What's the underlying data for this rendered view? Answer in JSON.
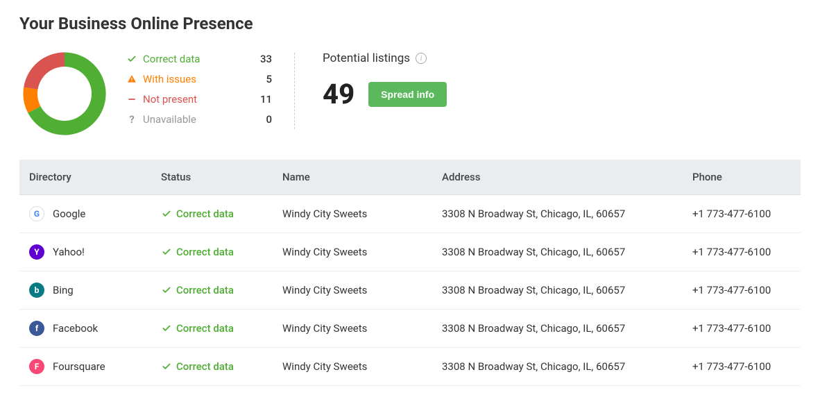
{
  "title": "Your Business Online Presence",
  "legend": {
    "correct": {
      "label": "Correct data",
      "count": 33
    },
    "with_issues": {
      "label": "With issues",
      "count": 5
    },
    "not_present": {
      "label": "Not present",
      "count": 11
    },
    "unavailable": {
      "label": "Unavailable",
      "count": 0
    }
  },
  "potential": {
    "label": "Potential listings",
    "count": 49,
    "button": "Spread info"
  },
  "table": {
    "headers": {
      "directory": "Directory",
      "status": "Status",
      "name": "Name",
      "address": "Address",
      "phone": "Phone"
    },
    "rows": [
      {
        "directory": "Google",
        "icon": "google",
        "status": "Correct data",
        "name": "Windy City Sweets",
        "address": "3308 N Broadway St, Chicago, IL, 60657",
        "phone": "+1 773-477-6100"
      },
      {
        "directory": "Yahoo!",
        "icon": "yahoo",
        "status": "Correct data",
        "name": "Windy City Sweets",
        "address": "3308 N Broadway St, Chicago, IL, 60657",
        "phone": "+1 773-477-6100"
      },
      {
        "directory": "Bing",
        "icon": "bing",
        "status": "Correct data",
        "name": "Windy City Sweets",
        "address": "3308 N Broadway St, Chicago, IL, 60657",
        "phone": "+1 773-477-6100"
      },
      {
        "directory": "Facebook",
        "icon": "facebook",
        "status": "Correct data",
        "name": "Windy City Sweets",
        "address": "3308 N Broadway St, Chicago, IL, 60657",
        "phone": "+1 773-477-6100"
      },
      {
        "directory": "Foursquare",
        "icon": "foursquare",
        "status": "Correct data",
        "name": "Windy City Sweets",
        "address": "3308 N Broadway St, Chicago, IL, 60657",
        "phone": "+1 773-477-6100"
      }
    ]
  },
  "chart_data": {
    "type": "pie",
    "title": "",
    "series": [
      {
        "name": "Correct data",
        "value": 33,
        "color": "#4fae33"
      },
      {
        "name": "With issues",
        "value": 5,
        "color": "#ff7f00"
      },
      {
        "name": "Not present",
        "value": 11,
        "color": "#d9534f"
      },
      {
        "name": "Unavailable",
        "value": 0,
        "color": "#999999"
      }
    ],
    "donut": true
  },
  "icons": {
    "google": {
      "bg": "#ffffff",
      "fg": "#4285F4",
      "letter": "G",
      "border": true
    },
    "yahoo": {
      "bg": "#5f01d1",
      "fg": "#ffffff",
      "letter": "Y"
    },
    "bing": {
      "bg": "#0a7b83",
      "fg": "#ffffff",
      "letter": "b"
    },
    "facebook": {
      "bg": "#3b5998",
      "fg": "#ffffff",
      "letter": "f"
    },
    "foursquare": {
      "bg": "#f94877",
      "fg": "#ffffff",
      "letter": "F"
    }
  }
}
